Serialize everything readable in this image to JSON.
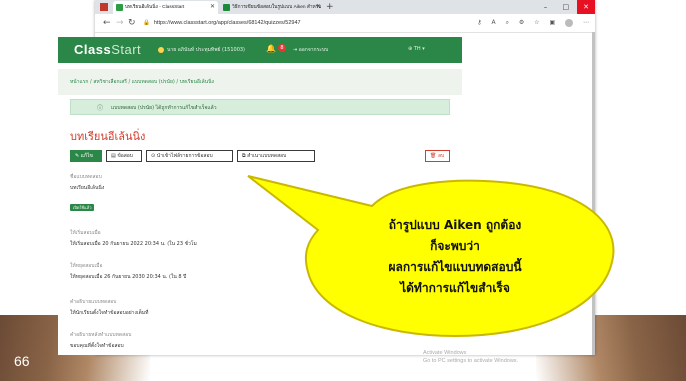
{
  "slide": {
    "number": "66"
  },
  "browser": {
    "tabs": [
      {
        "label": "บทเรียนอีเล้นนิ่ง - ClassStart"
      },
      {
        "label": "วิธีการเขียนข้อสอบในรูปแบบ Aiken สำหรับ"
      }
    ],
    "new_tab": "+",
    "window_buttons": [
      "–",
      "□",
      "✕"
    ],
    "url": "https://www.classstart.org/app/classes/68142/quizzes/52947"
  },
  "site": {
    "logo_main": "Class",
    "logo_accent": "Start",
    "user": "นาย อภินันท์ ประทุมทิพย์ (151003)",
    "badge_count": "8",
    "logout": "ออกจากระบบ",
    "language": "TH"
  },
  "page": {
    "breadcrumb": "หน้าแรก / สหวิชาเลือกเสรี / แบบทดสอบ (ปรนัย) / บทเรียนอีเล้นนิ่ง",
    "alert": "แบบทดสอบ (ปรนัย) ได้ถูกทำการแก้ไขสำเร็จแล้ว",
    "title": "บทเรียนอีเล้นนิ่ง",
    "buttons": {
      "edit": "แก้ไข",
      "questions": "ข้อสอบ",
      "preview": "นำเข้าไฟล์รายการข้อสอบ",
      "copy": "สำเนาแบบทดสอบ",
      "delete": "ลบ"
    },
    "fields": {
      "name_label": "ชื่อแบบทดสอบ",
      "name_value": "บทเรียนอีเล้นนิ่ง",
      "status_badge": "เปิดใช้แล้ว",
      "open_label": "ให้เริ่มสอบเมื่อ",
      "open_value": "ให้เริ่มสอบเมื่อ 20 กันยายน 2022 20:34 น. (ใน 23 ชั่วโม",
      "close_label": "ให้หยุดสอบเมื่อ",
      "close_value": "ให้หยุดสอบเมื่อ 26 กันยายน 2030 20:34 น. (ใน 8 ปี",
      "desc_label": "คำอธิบายแบบทดสอบ",
      "desc_value": "ให้นักเรียนตั้งใจทำข้อสอบอย่างเต็มที่",
      "after_label": "คำอธิบายหลังทำแบบทดสอบ",
      "after_value": "ขอบคุณที่ตั้งใจทำข้อสอบ"
    },
    "watermark_line1": "Activate Windows",
    "watermark_line2": "Go to PC settings to activate Windows."
  },
  "callout": {
    "lines": [
      "ถ้ารูปแบบ Aiken ถูกต้อง",
      "ก็จะพบว่า",
      "ผลการแก้ไขแบบทดสอบนี้",
      "ได้ทำการแก้ไขสำเร็จ"
    ],
    "fill_color": "#ffff00",
    "stroke_color": "#c9b800"
  }
}
